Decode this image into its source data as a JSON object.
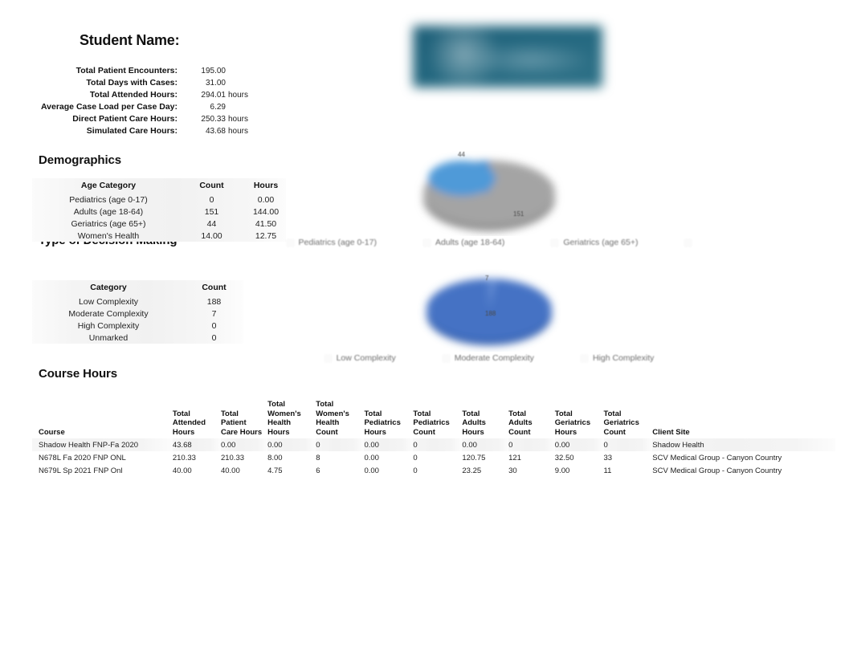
{
  "header": {
    "student_title": "Student Name:",
    "summary": [
      {
        "label": "Total Patient Encounters:",
        "value": "195.00",
        "unit": ""
      },
      {
        "label": "Total Days with Cases:",
        "value": "31.00",
        "unit": ""
      },
      {
        "label": "Total Attended Hours:",
        "value": "294.01",
        "unit": "hours"
      },
      {
        "label": "Average Case Load per Case Day:",
        "value": "6.29",
        "unit": ""
      },
      {
        "label": "Direct Patient Care Hours:",
        "value": "250.33",
        "unit": "hours"
      },
      {
        "label": "Simulated Care Hours:",
        "value": "43.68",
        "unit": "hours"
      }
    ],
    "logo": "organization-logo-banner"
  },
  "sections": {
    "demographics_title": "Demographics",
    "decision_title": "Type of Decision Making",
    "course_title": "Course Hours"
  },
  "demographics_table": {
    "headers": [
      "Age Category",
      "Count",
      "Hours"
    ],
    "rows": [
      [
        "Pediatrics (age 0-17)",
        "0",
        "0.00"
      ],
      [
        "Adults (age 18-64)",
        "151",
        "144.00"
      ],
      [
        "Geriatrics (age 65+)",
        "44",
        "41.50"
      ],
      [
        "Women's Health",
        "14.00",
        "12.75"
      ]
    ]
  },
  "decision_table": {
    "headers": [
      "Category",
      "Count"
    ],
    "rows": [
      [
        "Low Complexity",
        "188"
      ],
      [
        "Moderate Complexity",
        "7"
      ],
      [
        "High Complexity",
        "0"
      ],
      [
        "Unmarked",
        "0"
      ]
    ]
  },
  "chart_data": [
    {
      "type": "pie",
      "id": "demographics-pie",
      "title": "",
      "categories": [
        "Pediatrics (age 0-17)",
        "Adults (age 18-64)",
        "Geriatrics (age 65+)",
        "Women's Health"
      ],
      "values": [
        0,
        151,
        44,
        0
      ],
      "data_labels": [
        "",
        "151",
        "44",
        ""
      ],
      "colors": [
        "#5b9bd5",
        "#a0a0a0",
        "#5b9bd5",
        "#ffc000"
      ],
      "legend_position": "bottom",
      "legend": [
        "Pediatrics (age 0-17)",
        "Adults (age 18-64)",
        "Geriatrics (age 65+)",
        ""
      ],
      "grid": false
    },
    {
      "type": "pie",
      "id": "decision-pie",
      "title": "",
      "categories": [
        "Low Complexity",
        "Moderate Complexity",
        "High Complexity"
      ],
      "values": [
        188,
        7,
        0
      ],
      "data_labels": [
        "188",
        "7",
        ""
      ],
      "colors": [
        "#4472c4",
        "#4472c4",
        "#a0a0a0"
      ],
      "legend_position": "bottom",
      "legend": [
        "Low Complexity",
        "Moderate Complexity",
        "High Complexity"
      ],
      "grid": false
    }
  ],
  "course_table": {
    "headers": [
      "Course",
      "Total Attended Hours",
      "Total Patient Care Hours",
      "Total Women's Health Hours",
      "Total Women's Health Count",
      "Total Pediatrics Hours",
      "Total Pediatrics Count",
      "Total Adults Hours",
      "Total Adults Count",
      "Total Geriatrics Hours",
      "Total Geriatrics Count",
      "Client Site"
    ],
    "rows": [
      [
        "Shadow Health FNP-Fa 2020",
        "43.68",
        "0.00",
        "0.00",
        "0",
        "0.00",
        "0",
        "0.00",
        "0",
        "0.00",
        "0",
        "Shadow Health"
      ],
      [
        "N678L Fa 2020 FNP ONL",
        "210.33",
        "210.33",
        "8.00",
        "8",
        "0.00",
        "0",
        "120.75",
        "121",
        "32.50",
        "33",
        "SCV Medical Group - Canyon Country"
      ],
      [
        "N679L Sp 2021 FNP Onl",
        "40.00",
        "40.00",
        "4.75",
        "6",
        "0.00",
        "0",
        "23.25",
        "30",
        "9.00",
        "11",
        "SCV Medical Group - Canyon Country"
      ]
    ]
  }
}
